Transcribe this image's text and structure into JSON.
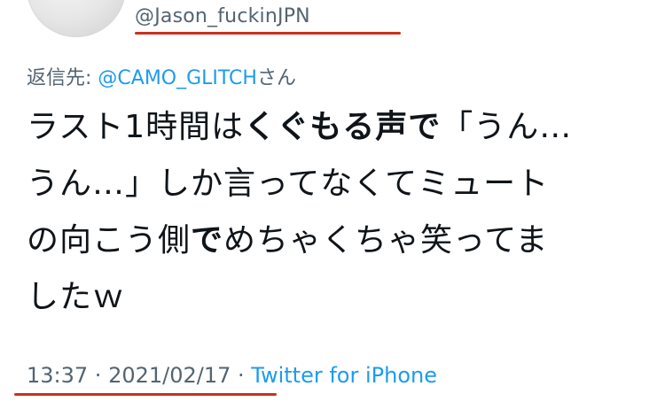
{
  "tweet": {
    "handle": "@Jason_fuckinJPN",
    "reply_prefix": "返信先: ",
    "reply_handle": "@CAMO_GLITCH",
    "reply_suffix": "さん",
    "text_lines": [
      [
        {
          "t": "ラスト1時間は",
          "b": false
        },
        {
          "t": "くぐもる声で",
          "b": true
        },
        {
          "t": "「うん…",
          "b": false
        }
      ],
      [
        {
          "t": "うん…」しか言ってなくてミュート",
          "b": false
        }
      ],
      [
        {
          "t": "の向こう側",
          "b": false
        },
        {
          "t": "で",
          "b": true
        },
        {
          "t": "めちゃくちゃ笑ってま",
          "b": false
        }
      ],
      [
        {
          "t": "したｗ",
          "b": false
        }
      ]
    ],
    "time": "13:37",
    "separator": " · ",
    "date": "2021/02/17",
    "source": "Twitter for iPhone"
  },
  "colors": {
    "text": "#0f1419",
    "secondary": "#536471",
    "link": "#1d9bf0",
    "annotation_underline": "#c8321f"
  }
}
